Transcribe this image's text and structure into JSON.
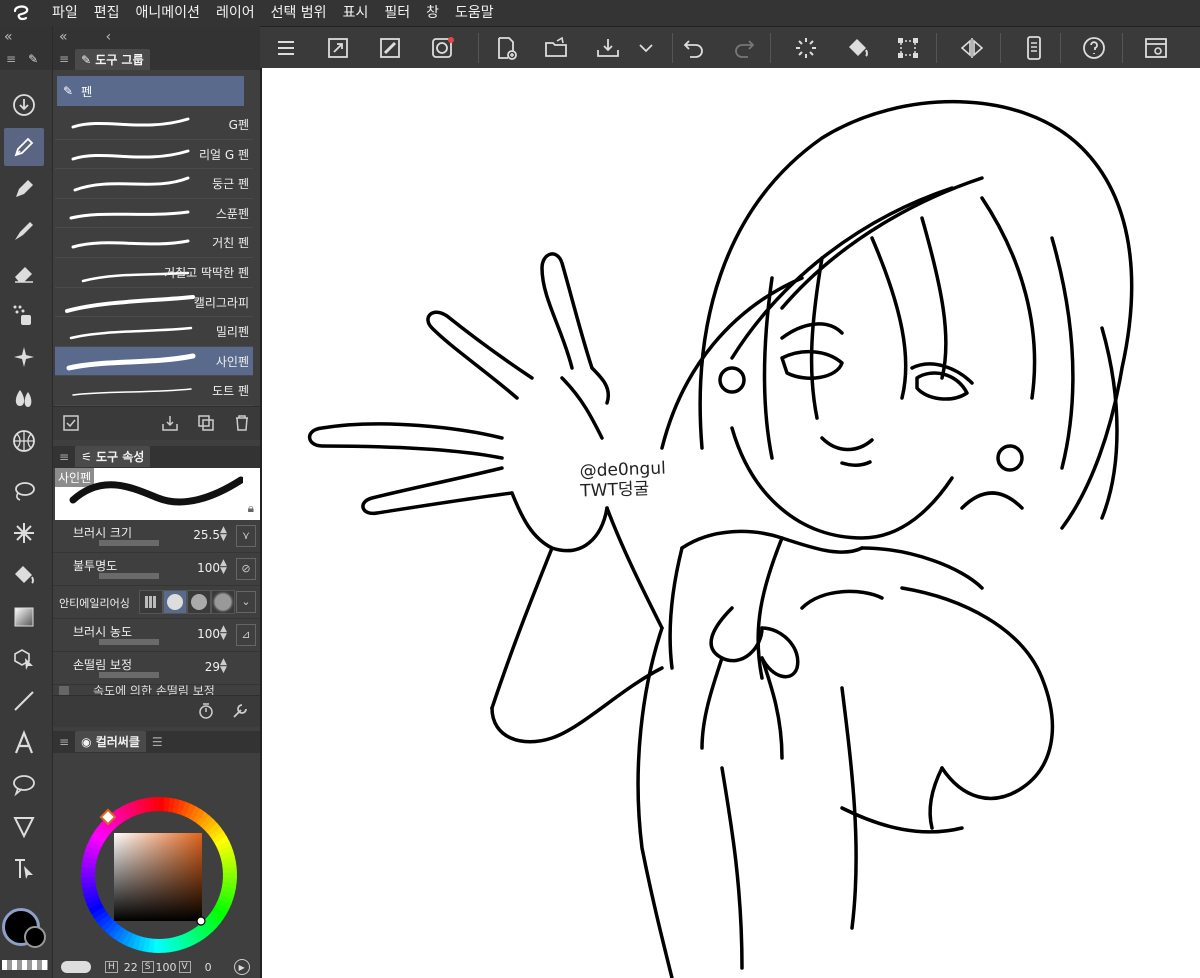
{
  "menu": [
    "파일",
    "편집",
    "애니메이션",
    "레이어",
    "선택 범위",
    "표시",
    "필터",
    "창",
    "도움말"
  ],
  "tool_group_panel": {
    "title": "도구 그룹",
    "group": "펜"
  },
  "brushes": [
    "G펜",
    "리얼 G 펜",
    "둥근 펜",
    "스푼펜",
    "거친 펜",
    "거칠고 딱딱한 펜",
    "캘리그라피",
    "밀리펜",
    "사인펜",
    "도트 펜"
  ],
  "selected_brush_index": 8,
  "tool_property": {
    "title": "도구 속성",
    "preview_label": "사인펜",
    "brush_size_label": "브러시 크기",
    "brush_size": "25.5",
    "opacity_label": "불투명도",
    "opacity": "100",
    "antialias_label": "안티에일리어싱",
    "density_label": "브러시 농도",
    "density": "100",
    "stabilization_label": "손떨림 보정",
    "stabilization": "29",
    "clipped_text": "속도에 의한 손떨림 보정"
  },
  "color_panel": {
    "title": "컬러써클"
  },
  "status": {
    "h_label": "H",
    "h": "22",
    "s_label": "S",
    "s": "100",
    "v_label": "V",
    "v": "0"
  },
  "canvas": {
    "watermark_line1": "@de0ngul",
    "watermark_line2": "TWT덩굴"
  },
  "colors": {
    "accent": "#5a6a8c",
    "main_color": "#000000",
    "background": "#2d2d2d"
  }
}
